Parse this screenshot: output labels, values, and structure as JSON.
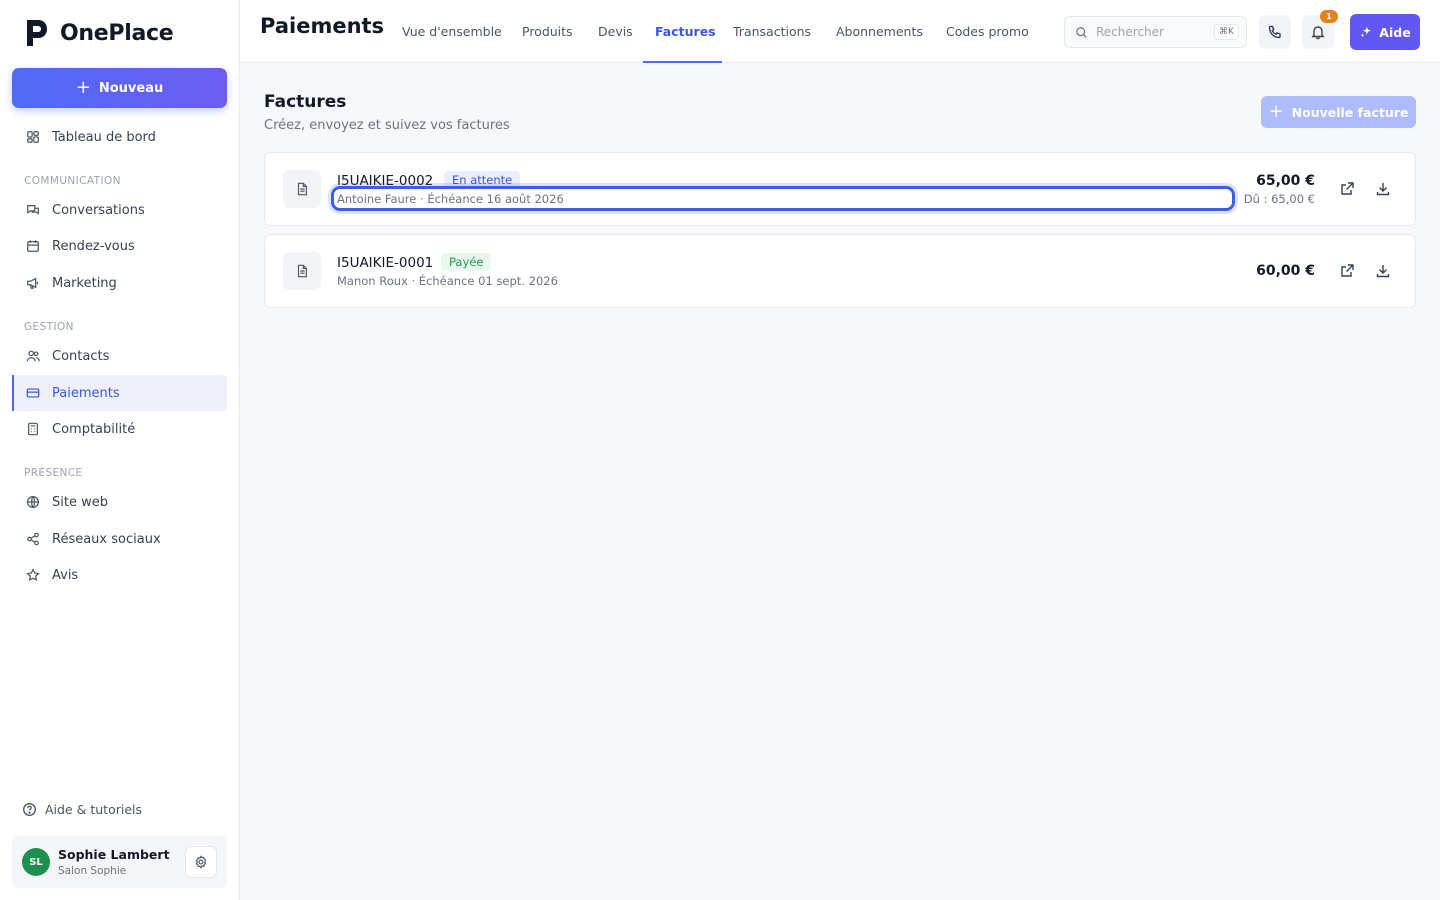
{
  "app": {
    "name": "OnePlace"
  },
  "sidebar": {
    "new_button": "Nouveau",
    "dashboard": "Tableau de bord",
    "sections": {
      "communication": "COMMUNICATION",
      "gestion": "GESTION",
      "presence": "PRÉSENCE"
    },
    "items": {
      "conversations": "Conversations",
      "rendezvous": "Rendez-vous",
      "marketing": "Marketing",
      "contacts": "Contacts",
      "paiements": "Paiements",
      "comptabilite": "Comptabilité",
      "siteweb": "Site web",
      "reseaux": "Réseaux sociaux",
      "avis": "Avis"
    },
    "help": "Aide & tutoriels",
    "user": {
      "initials": "SL",
      "name": "Sophie Lambert",
      "business": "Salon Sophie"
    }
  },
  "header": {
    "title": "Paiements",
    "tabs": [
      "Vue d'ensemble",
      "Produits",
      "Devis",
      "Factures",
      "Transactions",
      "Abonnements",
      "Codes promo"
    ],
    "active_tab": "Factures",
    "search_placeholder": "Rechercher",
    "search_shortcut": "⌘K",
    "notification_count": "1",
    "help_button": "Aide"
  },
  "main": {
    "title": "Factures",
    "subtitle": "Créez, envoyez et suivez vos factures",
    "new_invoice_button": "Nouvelle facture",
    "invoices": [
      {
        "number": "I5UAIKIE-0002",
        "status": "En attente",
        "meta": "Antoine Faure · Échéance 16 août 2026",
        "amount": "65,00 €",
        "due": "Dû : 65,00 €"
      },
      {
        "number": "I5UAIKIE-0001",
        "status": "Payée",
        "meta": "Manon Roux · Échéance 01 sept. 2026",
        "amount": "60,00 €"
      }
    ]
  },
  "colors": {
    "accent": "#4f6bf6",
    "help_button": "#6257f0",
    "status_pending": "#3b56d8",
    "status_paid": "#1e9a4b",
    "badge": "#e0821e"
  }
}
